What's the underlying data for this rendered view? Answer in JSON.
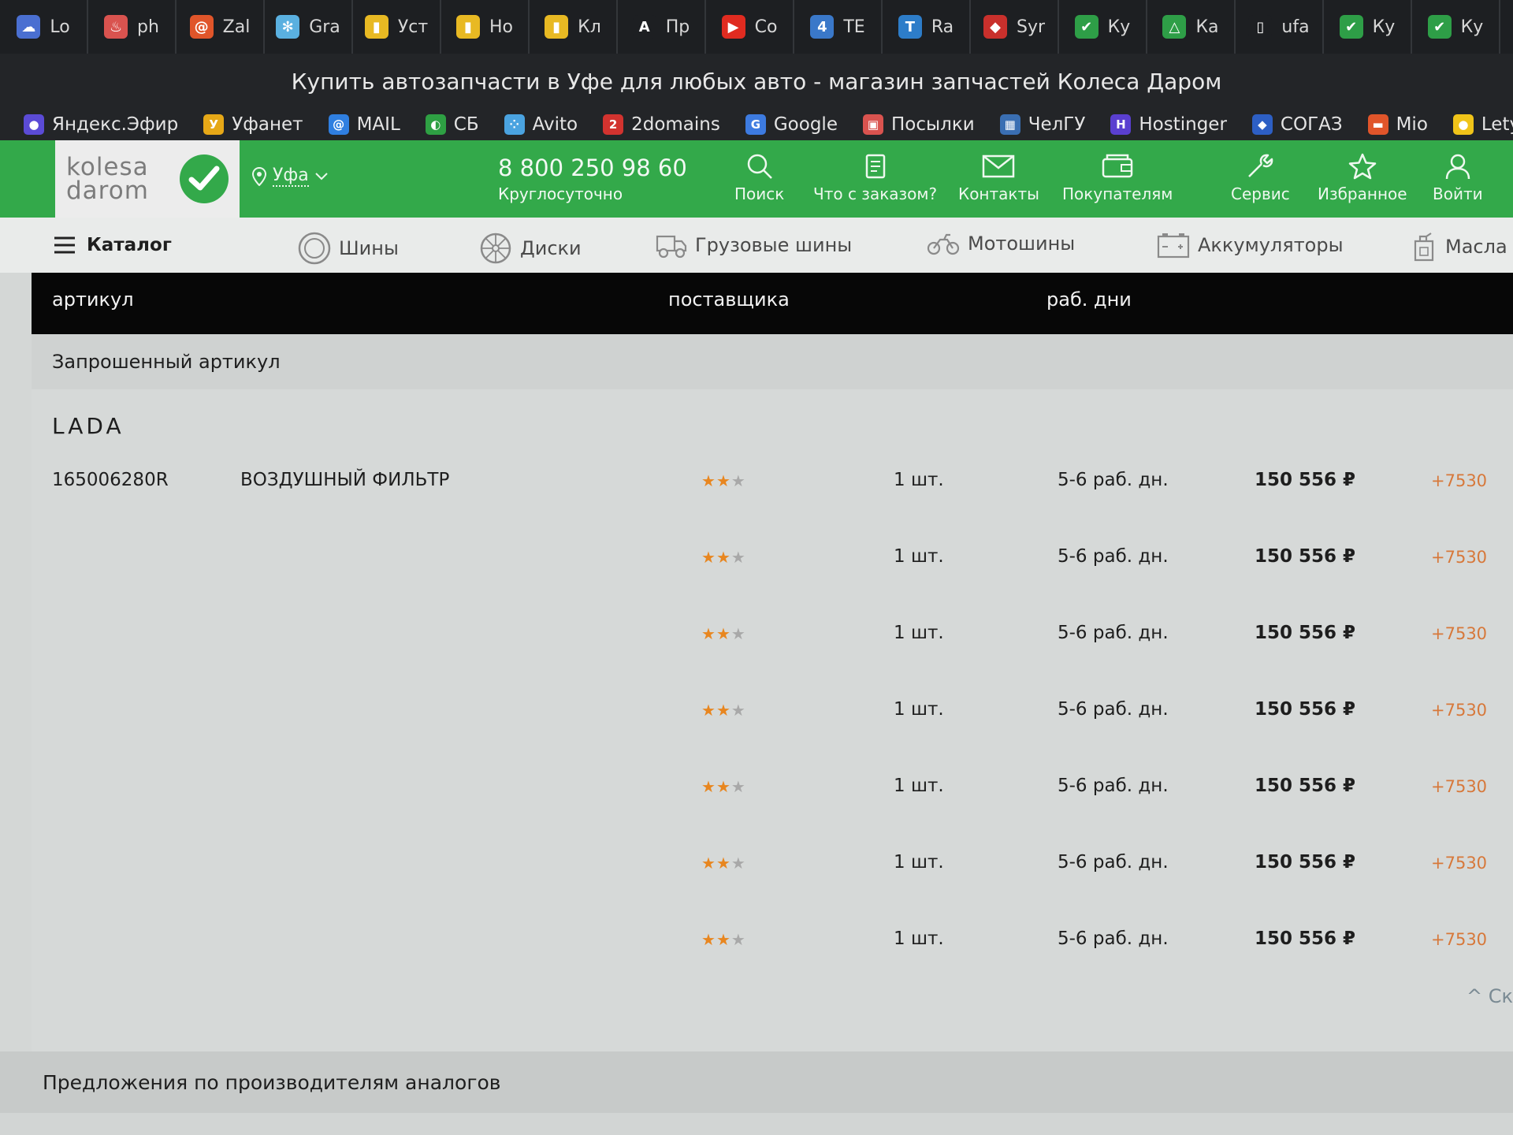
{
  "browser": {
    "tabs": [
      {
        "label": "Lo",
        "icon": "cloud-icon",
        "color": "#4a6fd1",
        "glyph": "☁"
      },
      {
        "label": "ph",
        "icon": "flame-icon",
        "color": "#d9534f",
        "glyph": "♨"
      },
      {
        "label": "Zal",
        "icon": "spiral-icon",
        "color": "#e0552a",
        "glyph": "@"
      },
      {
        "label": "Gra",
        "icon": "snowflake-icon",
        "color": "#5ab0e0",
        "glyph": "✻"
      },
      {
        "label": "Уст",
        "icon": "barcode-icon",
        "color": "#e8b923",
        "glyph": "▮"
      },
      {
        "label": "Но",
        "icon": "barcode-icon",
        "color": "#e8b923",
        "glyph": "▮"
      },
      {
        "label": "Кл",
        "icon": "barcode-icon",
        "color": "#e8b923",
        "glyph": "▮"
      },
      {
        "label": "Пр",
        "icon": "letter-a-icon",
        "color": "#1d1f22",
        "glyph": "A"
      },
      {
        "label": "Co",
        "icon": "youtube-icon",
        "color": "#e02b20",
        "glyph": "▶"
      },
      {
        "label": "TE",
        "icon": "four-icon",
        "color": "#3a78c9",
        "glyph": "4"
      },
      {
        "label": "Ra",
        "icon": "t-icon",
        "color": "#2d7dc9",
        "glyph": "T"
      },
      {
        "label": "Syr",
        "icon": "lips-icon",
        "color": "#c9302c",
        "glyph": "◆"
      },
      {
        "label": "Ку",
        "icon": "check-icon",
        "color": "#2e9e47",
        "glyph": "✔"
      },
      {
        "label": "Ка",
        "icon": "triangle-icon",
        "color": "#2e9e47",
        "glyph": "△"
      },
      {
        "label": "ufa",
        "icon": "document-icon",
        "color": "#1d1f22",
        "glyph": "▯"
      },
      {
        "label": "Ку",
        "icon": "check-icon",
        "color": "#2e9e47",
        "glyph": "✔"
      },
      {
        "label": "Ку",
        "icon": "check-icon",
        "color": "#2e9e47",
        "glyph": "✔"
      }
    ],
    "window_title": "Купить автозапчасти в Уфе для любых авто - магазин запчастей Колеса Даром",
    "bookmarks": [
      {
        "label": "Яндекс.Эфир",
        "icon": "yandex-efir-icon",
        "color": "#5b4bd6",
        "glyph": "●"
      },
      {
        "label": "Уфанет",
        "icon": "ufanet-icon",
        "color": "#e6a817",
        "glyph": "У"
      },
      {
        "label": "MAIL",
        "icon": "mail-at-icon",
        "color": "#2f7fe0",
        "glyph": "@"
      },
      {
        "label": "СБ",
        "icon": "sber-icon",
        "color": "#2ea043",
        "glyph": "◐"
      },
      {
        "label": "Avito",
        "icon": "avito-icon",
        "color": "#4aa3e0",
        "glyph": "⁘"
      },
      {
        "label": "2domains",
        "icon": "twodomains-icon",
        "color": "#d2332f",
        "glyph": "2"
      },
      {
        "label": "Google",
        "icon": "google-translate-icon",
        "color": "#3d7be0",
        "glyph": "G"
      },
      {
        "label": "Посылки",
        "icon": "gift-icon",
        "color": "#d9534f",
        "glyph": "▣"
      },
      {
        "label": "ЧелГУ",
        "icon": "chelgu-icon",
        "color": "#3a6fb3",
        "glyph": "▦"
      },
      {
        "label": "Hostinger",
        "icon": "hostinger-icon",
        "color": "#5a3fd0",
        "glyph": "H"
      },
      {
        "label": "СОГАЗ",
        "icon": "sogaz-icon",
        "color": "#2d5fc4",
        "glyph": "◆"
      },
      {
        "label": "Mio",
        "icon": "mio-icon",
        "color": "#e0552a",
        "glyph": "▬"
      },
      {
        "label": "LetyShops",
        "icon": "letyshops-icon",
        "color": "#f0c419",
        "glyph": "●"
      }
    ]
  },
  "site": {
    "logo_line1": "kolesa",
    "logo_line2": "darom",
    "city": "Уфа",
    "phone": "8 800 250 98 60",
    "phone_hours": "Круглосуточно",
    "nav": {
      "search": "Поиск",
      "order_status": "Что с заказом?",
      "contacts": "Контакты",
      "customers": "Покупателям",
      "service": "Сервис",
      "favorites": "Избранное",
      "login": "Войти"
    },
    "catalog_label": "Каталог",
    "categories": {
      "tires": "Шины",
      "wheels": "Диски",
      "truck_tires": "Грузовые шины",
      "moto_tires": "Мотошины",
      "batteries": "Аккумуляторы",
      "oils": "Масла"
    }
  },
  "table": {
    "headers": {
      "article": "артикул",
      "supplier": "поставщика",
      "term": "раб. дни"
    },
    "requested_label": "Запрошенный артикул",
    "brand": "LADA",
    "part_number": "165006280R",
    "part_name": "ВОЗДУШНЫЙ ФИЛЬТР",
    "rows": [
      {
        "rating": 2,
        "qty": "1 шт.",
        "term": "5-6 раб. дн.",
        "price": "150 556 ₽",
        "bonus": "+7530"
      },
      {
        "rating": 2,
        "qty": "1 шт.",
        "term": "5-6 раб. дн.",
        "price": "150 556 ₽",
        "bonus": "+7530"
      },
      {
        "rating": 2,
        "qty": "1 шт.",
        "term": "5-6 раб. дн.",
        "price": "150 556 ₽",
        "bonus": "+7530"
      },
      {
        "rating": 2,
        "qty": "1 шт.",
        "term": "5-6 раб. дн.",
        "price": "150 556 ₽",
        "bonus": "+7530"
      },
      {
        "rating": 2,
        "qty": "1 шт.",
        "term": "5-6 раб. дн.",
        "price": "150 556 ₽",
        "bonus": "+7530"
      },
      {
        "rating": 2,
        "qty": "1 шт.",
        "term": "5-6 раб. дн.",
        "price": "150 556 ₽",
        "bonus": "+7530"
      },
      {
        "rating": 2,
        "qty": "1 шт.",
        "term": "5-6 раб. дн.",
        "price": "150 556 ₽",
        "bonus": "+7530"
      }
    ],
    "rating_max": 3,
    "scroll_label": "Ск",
    "analogs_label": "Предложения по производителям аналогов"
  },
  "colors": {
    "brand_green": "#33a94a",
    "star": "#e8861f",
    "bonus": "#d7783a"
  }
}
